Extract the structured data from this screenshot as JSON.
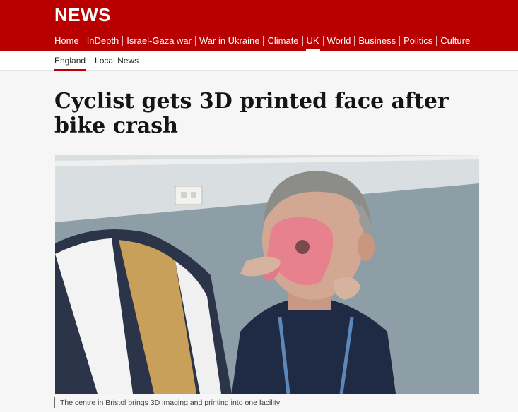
{
  "header": {
    "logo": "NEWS",
    "nav": [
      {
        "label": "Home",
        "active": false
      },
      {
        "label": "InDepth",
        "active": false
      },
      {
        "label": "Israel-Gaza war",
        "active": false
      },
      {
        "label": "War in Ukraine",
        "active": false
      },
      {
        "label": "Climate",
        "active": false
      },
      {
        "label": "UK",
        "active": true
      },
      {
        "label": "World",
        "active": false
      },
      {
        "label": "Business",
        "active": false
      },
      {
        "label": "Politics",
        "active": false
      },
      {
        "label": "Culture",
        "active": false
      }
    ]
  },
  "subnav": {
    "items": [
      {
        "label": "England",
        "active": true
      },
      {
        "label": "Local News",
        "active": false
      }
    ]
  },
  "article": {
    "headline_line1": "Cyclist gets 3D printed face after",
    "headline_line2": "bike crash",
    "image_caption": "The centre in Bristol brings 3D imaging and printing into one facility"
  },
  "colors": {
    "brand_red": "#b80000",
    "page_bg": "#f6f6f6",
    "text": "#141414"
  }
}
